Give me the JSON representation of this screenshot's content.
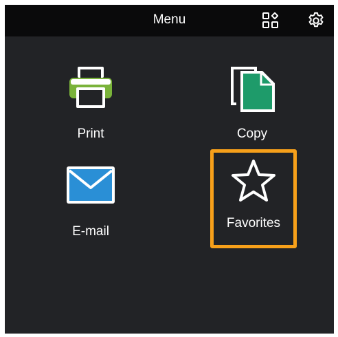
{
  "header": {
    "title": "Menu",
    "apps_icon": "apps-grid-icon",
    "settings_icon": "gear-icon"
  },
  "tiles": [
    {
      "label": "Print",
      "icon": "printer-icon",
      "accent": "#7ab33a"
    },
    {
      "label": "Copy",
      "icon": "copy-documents-icon",
      "accent": "#1e9b6a"
    },
    {
      "label": "E-mail",
      "icon": "envelope-icon",
      "accent": "#2a8fd6"
    },
    {
      "label": "Favorites",
      "icon": "star-icon",
      "selected": true
    }
  ],
  "colors": {
    "background": "#222326",
    "header": "#0a0a0b",
    "highlight": "#f7a01a"
  }
}
